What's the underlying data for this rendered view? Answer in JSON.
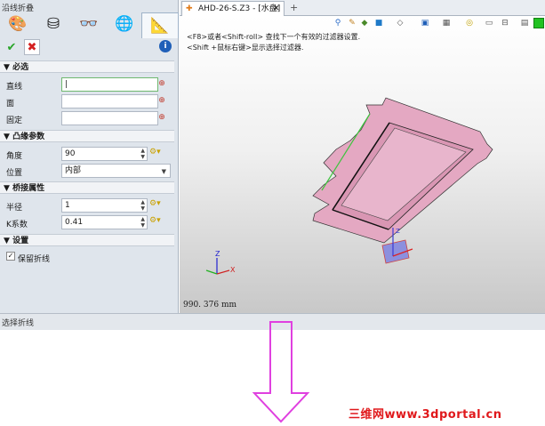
{
  "panel": {
    "title": "沿线折叠",
    "tabs": [
      {
        "icon": "palette-icon"
      },
      {
        "icon": "stamp-icon"
      },
      {
        "icon": "glasses-icon"
      },
      {
        "icon": "globe-icon"
      },
      {
        "icon": "sheetmetal-icon"
      }
    ],
    "ok_glyph": "✔",
    "cancel_glyph": "✖",
    "info_glyph": "i",
    "sections": {
      "required": {
        "title": "必选",
        "fields": [
          {
            "label": "直线",
            "value": "|"
          },
          {
            "label": "面",
            "value": ""
          },
          {
            "label": "固定",
            "value": ""
          }
        ]
      },
      "bend_params": {
        "title": "凸缘参数",
        "angle_label": "角度",
        "angle_value": "90",
        "position_label": "位置",
        "position_value": "内部"
      },
      "bridge": {
        "title": "桥接属性",
        "radius_label": "半径",
        "radius_value": "1",
        "k_label": "K系数",
        "k_value": "0.41"
      },
      "settings": {
        "title": "设置",
        "keep_label": "保留折线",
        "keep_checked": true
      }
    }
  },
  "document_tab": {
    "label": "AHD-26-S.Z3 - [水盘]",
    "close": "✕",
    "add": "+"
  },
  "viewport": {
    "hint1": "<F8>或者<Shift-roll> 查找下一个有效的过滤器设置.",
    "hint2": "<Shift +鼠标右键>显示选择过滤器.",
    "scale_readout": "990. 376  mm",
    "model_color": "#e4a8c2"
  },
  "status": {
    "text": "选择折线"
  },
  "watermark": {
    "text": "三维网www.3dportal.cn"
  },
  "annotation_arrow_color": "#e040e0"
}
